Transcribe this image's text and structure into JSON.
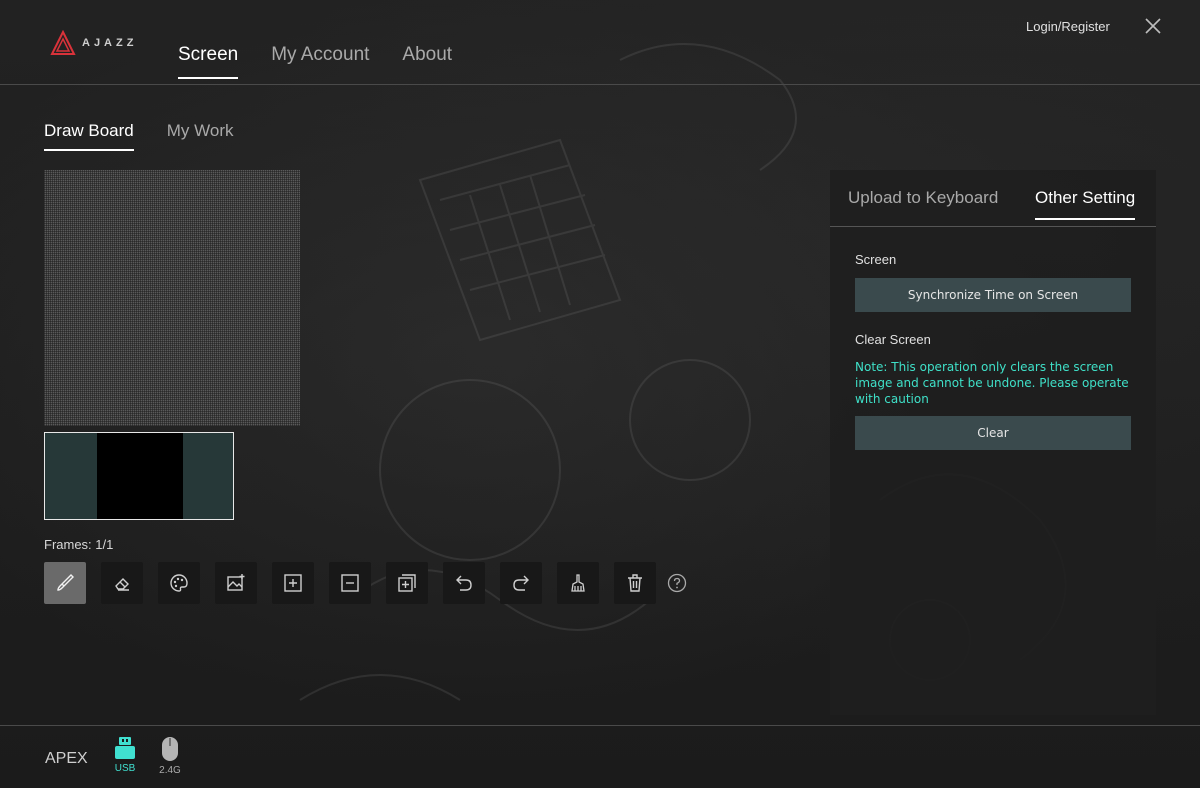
{
  "brand": {
    "name": "AJAZZ",
    "accent": "#d9323a"
  },
  "header": {
    "nav": [
      "Screen",
      "My Account",
      "About"
    ],
    "active_nav": "Screen",
    "login_label": "Login/Register"
  },
  "subtabs": {
    "items": [
      "Draw Board",
      "My Work"
    ],
    "active": "Draw Board"
  },
  "canvas": {
    "frames_label": "Frames: 1/1"
  },
  "toolbar": {
    "tools": [
      "brush-icon",
      "eraser-icon",
      "palette-icon",
      "image-icon",
      "add-frame-icon",
      "remove-frame-icon",
      "copy-frame-icon",
      "undo-icon",
      "redo-icon",
      "clear-icon",
      "trash-icon",
      "help-icon"
    ],
    "active_tool": "brush-icon"
  },
  "panel": {
    "tabs": [
      "Upload to Keyboard",
      "Other Setting"
    ],
    "active_tab": "Other Setting",
    "screen_label": "Screen",
    "sync_button": "Synchronize Time on Screen",
    "clear_label": "Clear Screen",
    "note": "Note: This operation only clears the screen image and cannot be undone. Please operate with caution",
    "clear_button": "Clear",
    "note_color": "#3fe0c8",
    "button_color": "#3a4a4d"
  },
  "footer": {
    "device": "APEX",
    "connections": [
      {
        "label": "USB",
        "active": true,
        "color": "#40e0d0"
      },
      {
        "label": "2.4G",
        "active": false
      }
    ]
  }
}
